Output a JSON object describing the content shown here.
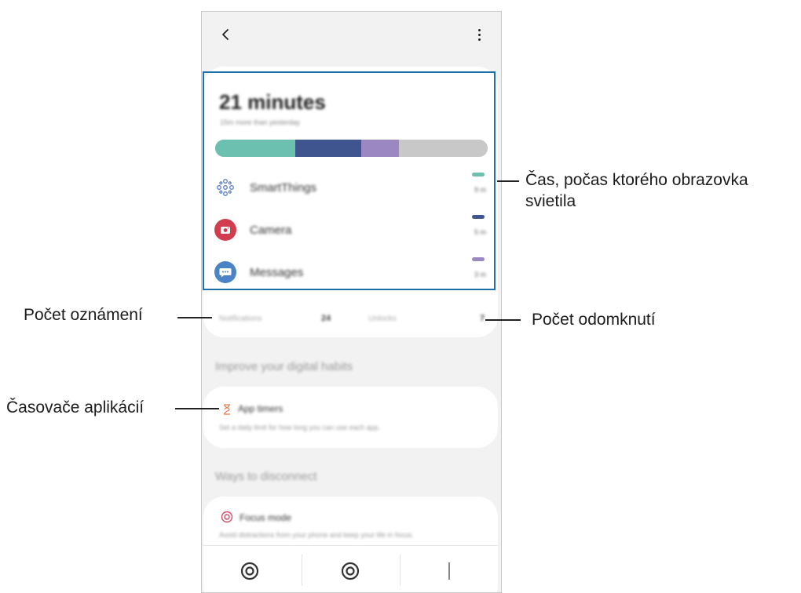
{
  "annotations": {
    "screen_time": "Čas, počas ktorého obrazovka svietila",
    "notifications": "Počet oznámení",
    "unlocks": "Počet odomknutí",
    "app_timers": "Časovače aplikácií"
  },
  "summary": {
    "total_time": "21 minutes",
    "compare_text": "15m more than yesterday",
    "usage_bar": [
      {
        "color": "#6cc0b0",
        "fraction": 0.295
      },
      {
        "color": "#3e5590",
        "fraction": 0.24
      },
      {
        "color": "#9b87c2",
        "fraction": 0.14
      },
      {
        "color": "#c8c8c8",
        "fraction": 0.325
      }
    ],
    "apps": [
      {
        "name": "SmartThings",
        "duration": "9 m",
        "icon": "smartthings-icon",
        "color": "#6cc0b0"
      },
      {
        "name": "Camera",
        "duration": "5 m",
        "icon": "camera-icon",
        "color": "#3e5590"
      },
      {
        "name": "Messages",
        "duration": "3 m",
        "icon": "messages-icon",
        "color": "#9b87c2"
      }
    ]
  },
  "stats": {
    "notifications_label": "Notifications",
    "notifications_value": "24",
    "unlocks_label": "Unlocks",
    "unlocks_value": "7"
  },
  "habits": {
    "section_title": "Improve your digital habits",
    "app_timers_title": "App timers",
    "app_timers_sub": "Set a daily limit for how long you can use each app."
  },
  "disconnect": {
    "section_title": "Ways to disconnect",
    "focus_title": "Focus mode",
    "focus_sub": "Avoid distractions from your phone and keep your life in focus."
  },
  "colors": {
    "highlight_border": "#1e6fa8",
    "camera_icon_bg": "#d23c4f",
    "messages_icon_bg": "#4a83c6",
    "smartthings_icon": "#5b7fbf",
    "timer_icon": "#e07a4a",
    "focus_icon": "#d24a6a"
  }
}
